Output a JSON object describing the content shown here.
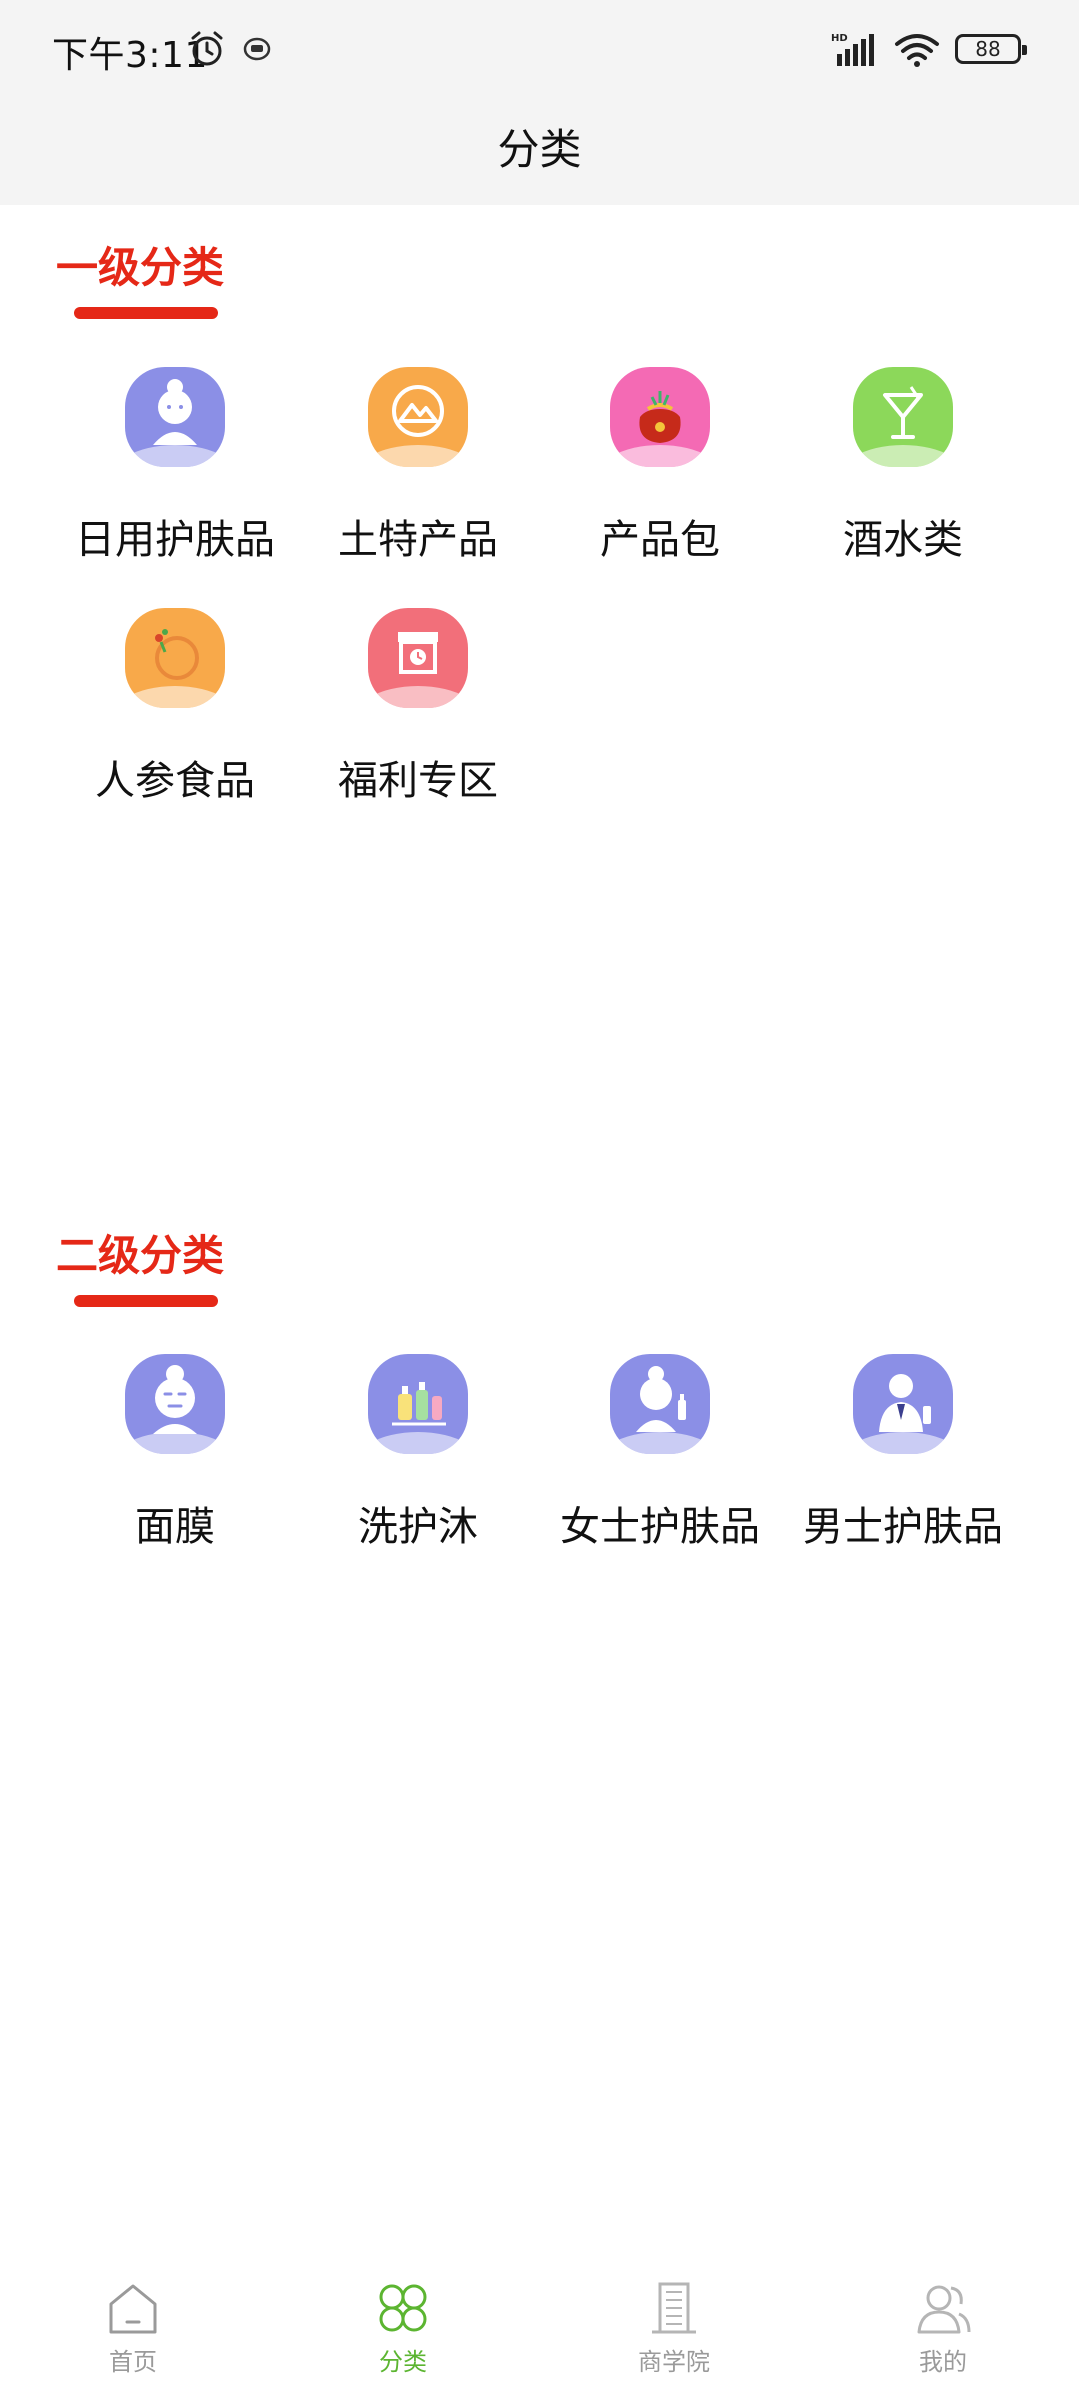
{
  "status_bar": {
    "time": "下午3:11",
    "battery": "88",
    "network": "HD"
  },
  "header": {
    "title": "分类"
  },
  "level1": {
    "title": "一级分类",
    "items": [
      {
        "label": "日用护肤品",
        "icon": "woman-face-icon",
        "color": "#8b8fe6"
      },
      {
        "label": "土特产品",
        "icon": "mountain-icon",
        "color": "#f8a94a"
      },
      {
        "label": "产品包",
        "icon": "gift-bag-icon",
        "color": "#f46ab4"
      },
      {
        "label": "酒水类",
        "icon": "cocktail-glass-icon",
        "color": "#8cd85a"
      },
      {
        "label": "人参食品",
        "icon": "ginseng-icon",
        "color": "#f8a94a"
      },
      {
        "label": "福利专区",
        "icon": "welfare-box-icon",
        "color": "#f26f7a"
      }
    ]
  },
  "level2": {
    "title": "二级分类",
    "items": [
      {
        "label": "面膜",
        "icon": "face-mask-icon",
        "color": "#8b8fe6"
      },
      {
        "label": "洗护沐",
        "icon": "bottles-icon",
        "color": "#8b8fe6"
      },
      {
        "label": "女士护肤品",
        "icon": "woman-skincare-icon",
        "color": "#8b8fe6"
      },
      {
        "label": "男士护肤品",
        "icon": "man-skincare-icon",
        "color": "#8b8fe6"
      }
    ]
  },
  "bottom_nav": {
    "items": [
      {
        "label": "首页",
        "icon": "home-icon",
        "active": false
      },
      {
        "label": "分类",
        "icon": "category-icon",
        "active": true
      },
      {
        "label": "商学院",
        "icon": "building-icon",
        "active": false
      },
      {
        "label": "我的",
        "icon": "user-icon",
        "active": false
      }
    ],
    "active_color": "#5cb531",
    "inactive_color": "#9a9a9a"
  },
  "accent_color": "#e52817"
}
